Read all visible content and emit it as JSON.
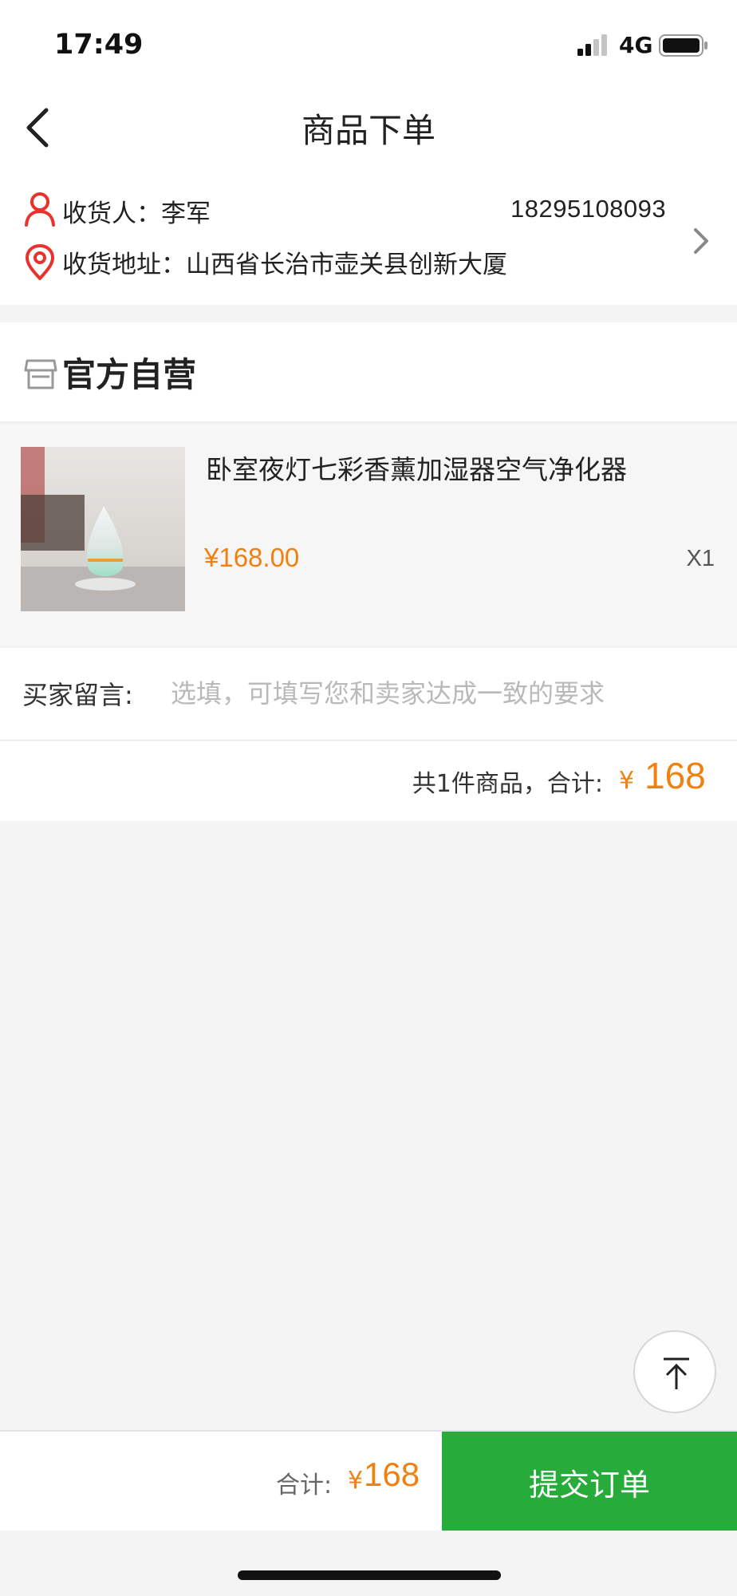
{
  "status_bar": {
    "time": "17:49",
    "network": "4G",
    "icons": [
      "signal-icon",
      "battery-icon"
    ]
  },
  "nav": {
    "title": "商品下单",
    "back_icon": "chevron-left-icon"
  },
  "address": {
    "recipient": "收货人：李军",
    "phone": "18295108093",
    "address": "收货地址：山西省长治市壶关县创新大厦",
    "icons": [
      "person-icon",
      "location-pin-icon",
      "chevron-right-icon"
    ]
  },
  "shop": {
    "name": "官方自营",
    "icon": "store-icon"
  },
  "product": {
    "name": "卧室夜灯七彩香薰加湿器空气净化器",
    "price": "¥168.00",
    "quantity": "X1"
  },
  "message": {
    "label": "买家留言:",
    "placeholder": "选填，可填写您和卖家达成一致的要求",
    "value": ""
  },
  "summary": {
    "text": "共1件商品，合计:",
    "currency": "¥",
    "amount": "168"
  },
  "bottom_bar": {
    "total_label": "合计:",
    "currency": "¥",
    "total_amount": "168",
    "submit_label": "提交订单"
  },
  "colors": {
    "accent_orange": "#f08010",
    "submit_green": "#27ac3c",
    "icon_red": "#e8322e"
  }
}
